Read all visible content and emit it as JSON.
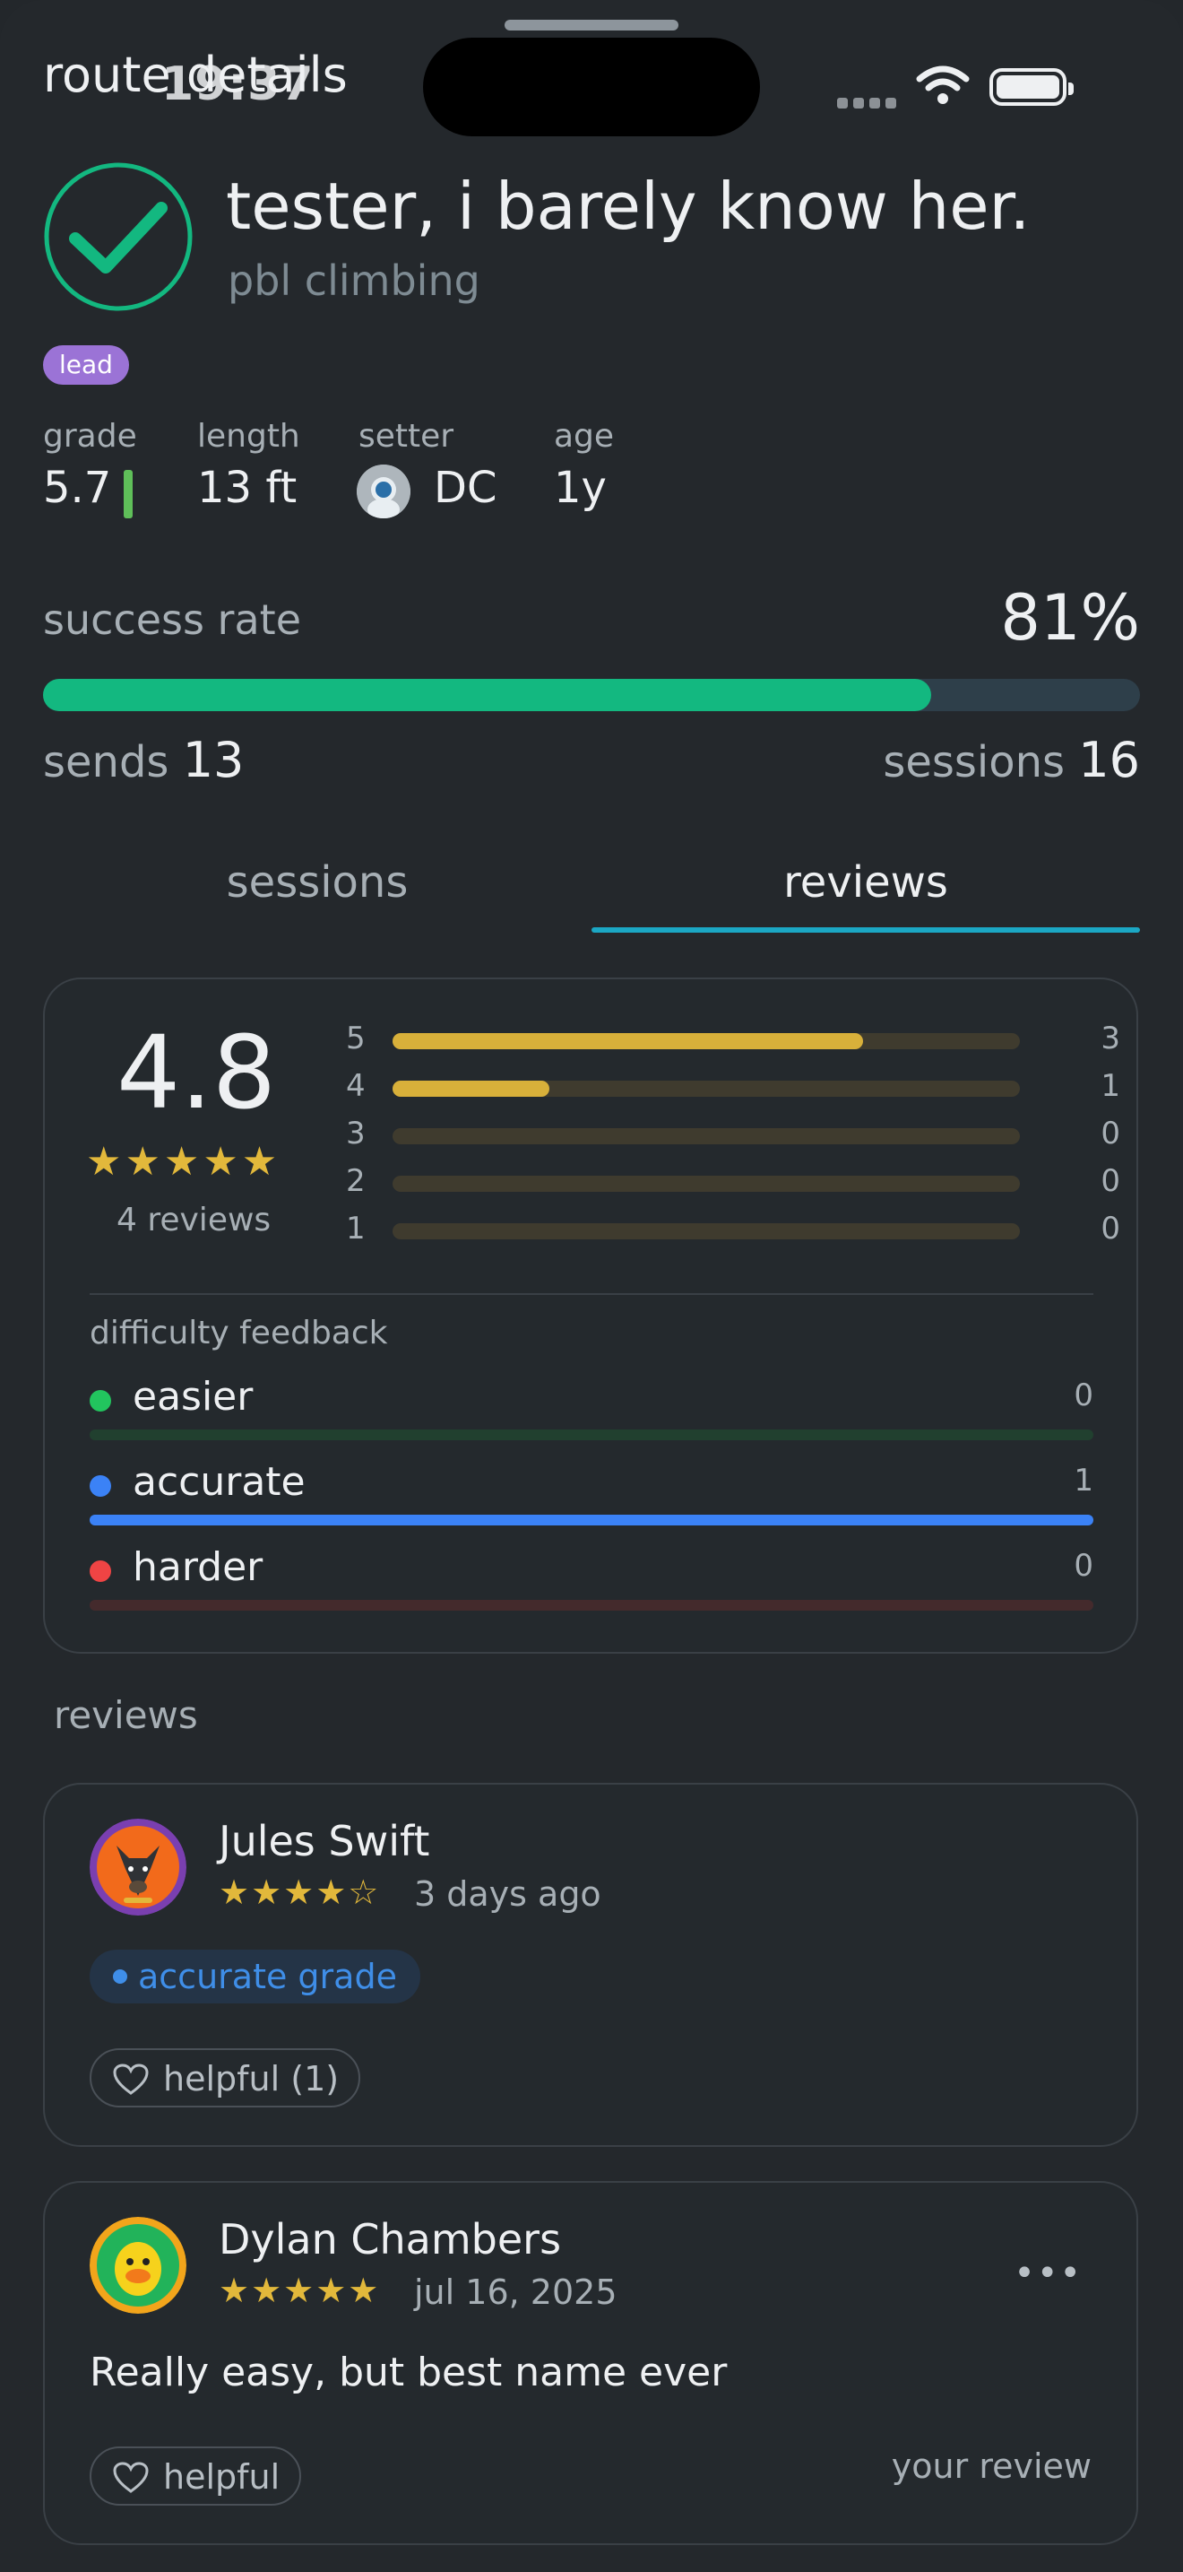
{
  "sheet": {
    "title": "route details"
  },
  "status_bar": {
    "time": "19:37"
  },
  "route": {
    "name": "tester, i barely know her.",
    "gym": "pbl climbing",
    "type_badge": "lead",
    "grade_label": "grade",
    "grade": "5.7",
    "length_label": "length",
    "length": "13 ft",
    "setter_label": "setter",
    "setter": "DC",
    "age_label": "age",
    "age": "1y"
  },
  "success": {
    "label": "success rate",
    "rate_text": "81%",
    "rate": 0.81,
    "sends_label": "sends",
    "sends": "13",
    "sessions_label": "sessions",
    "sessions": "16"
  },
  "tabs": [
    {
      "label": "sessions"
    },
    {
      "label": "reviews"
    }
  ],
  "summary": {
    "average": "4.8",
    "stars": "★★★★★",
    "count_text": "4 reviews",
    "histogram": [
      {
        "star": "5",
        "count": "3",
        "fraction": 0.75
      },
      {
        "star": "4",
        "count": "1",
        "fraction": 0.25
      },
      {
        "star": "3",
        "count": "0",
        "fraction": 0
      },
      {
        "star": "2",
        "count": "0",
        "fraction": 0
      },
      {
        "star": "1",
        "count": "0",
        "fraction": 0
      }
    ],
    "difficulty_title": "difficulty feedback",
    "difficulty": [
      {
        "label": "easier",
        "count": "0",
        "fraction": 0,
        "color": "#22c55e",
        "track": "#21402f"
      },
      {
        "label": "accurate",
        "count": "1",
        "fraction": 1,
        "color": "#3b82f6",
        "track": "#1f3352"
      },
      {
        "label": "harder",
        "count": "0",
        "fraction": 0,
        "color": "#ef4444",
        "track": "#442a2c"
      }
    ]
  },
  "reviews_title": "reviews",
  "reviews": [
    {
      "name": "Jules Swift",
      "stars": "★★★★☆",
      "date": "3 days ago",
      "tag": "accurate grade",
      "helpful": "helpful (1)"
    },
    {
      "name": "Dylan Chambers",
      "stars": "★★★★★",
      "date": "jul 16, 2025",
      "text": "Really easy, but best name ever",
      "helpful": "helpful",
      "more": "•••",
      "own_label": "your review"
    }
  ],
  "colors": {
    "accent_green": "#13b880",
    "accent_blue": "#1ba7c4",
    "star": "#e2b83b",
    "lead_badge": "#9b73d6"
  }
}
